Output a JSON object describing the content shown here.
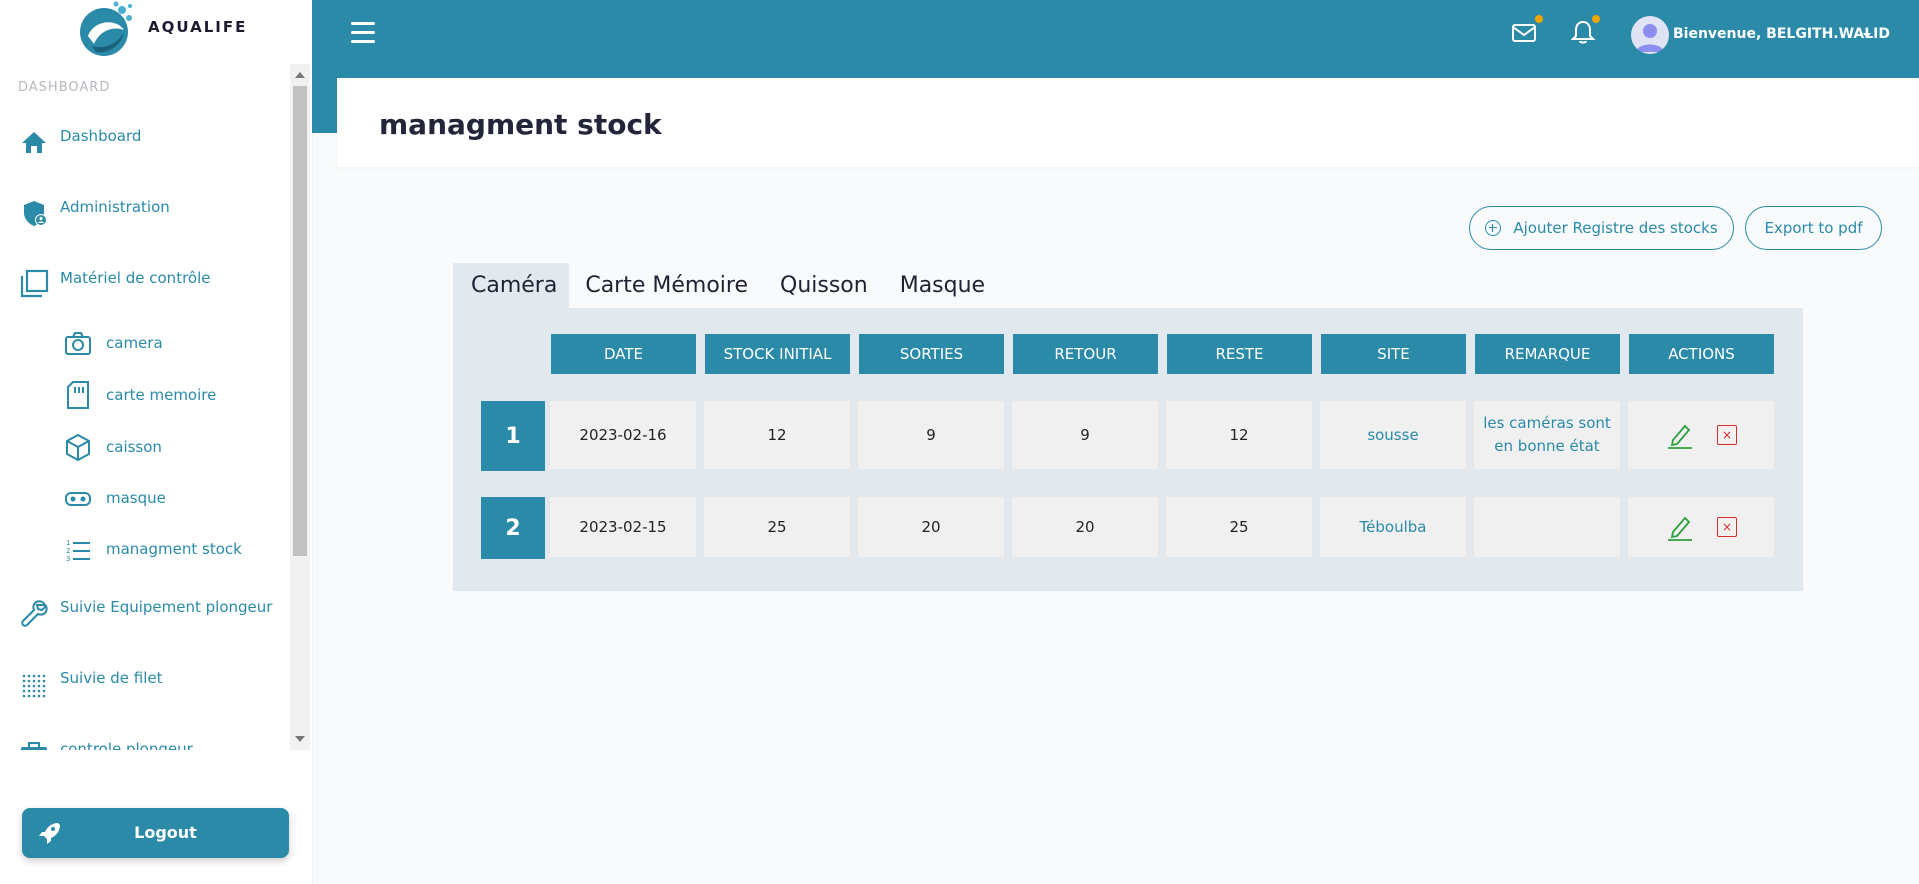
{
  "brand": "AQUALIFE",
  "sidebar": {
    "section_title": "DASHBOARD",
    "items": [
      {
        "label": "Dashboard",
        "icon": "home-icon"
      },
      {
        "label": "Administration",
        "icon": "shield-user-icon"
      },
      {
        "label": "Matériel de contrôle",
        "icon": "copy-icon"
      },
      {
        "label": "Suivie Equipement plongeur",
        "icon": "wrench-icon"
      },
      {
        "label": "Suivie de filet",
        "icon": "grid-dots-icon"
      },
      {
        "label": "controle plongeur",
        "icon": "briefcase-icon"
      }
    ],
    "sub_items": [
      {
        "label": "camera",
        "icon": "camera-icon"
      },
      {
        "label": "carte memoire",
        "icon": "sd-card-icon"
      },
      {
        "label": "caisson",
        "icon": "box-icon"
      },
      {
        "label": "masque",
        "icon": "mask-icon"
      },
      {
        "label": "managment stock",
        "icon": "list-icon"
      }
    ],
    "logout_label": "Logout"
  },
  "topbar": {
    "welcome": "Bienvenue, BELGITH.WALID",
    "accent_color": "#2a8aa8",
    "notification_dot_color": "#f0a500"
  },
  "page": {
    "title": "managment stock",
    "add_button": "Ajouter Registre des stocks",
    "export_button": "Export to pdf"
  },
  "tabs": [
    {
      "label": "Caméra",
      "active": true
    },
    {
      "label": "Carte Mémoire",
      "active": false
    },
    {
      "label": "Quisson",
      "active": false
    },
    {
      "label": "Masque",
      "active": false
    }
  ],
  "table": {
    "headers": [
      "DATE",
      "STOCK INITIAL",
      "SORTIES",
      "RETOUR",
      "RESTE",
      "SITE",
      "REMARQUE",
      "ACTIONS"
    ],
    "rows": [
      {
        "num": "1",
        "date": "2023-02-16",
        "stock_initial": "12",
        "sorties": "9",
        "retour": "9",
        "reste": "12",
        "site": "sousse",
        "remarque": "les caméras sont en bonne état"
      },
      {
        "num": "2",
        "date": "2023-02-15",
        "stock_initial": "25",
        "sorties": "20",
        "retour": "20",
        "reste": "25",
        "site": "Téboulba",
        "remarque": ""
      }
    ],
    "delete_glyph": "×"
  }
}
